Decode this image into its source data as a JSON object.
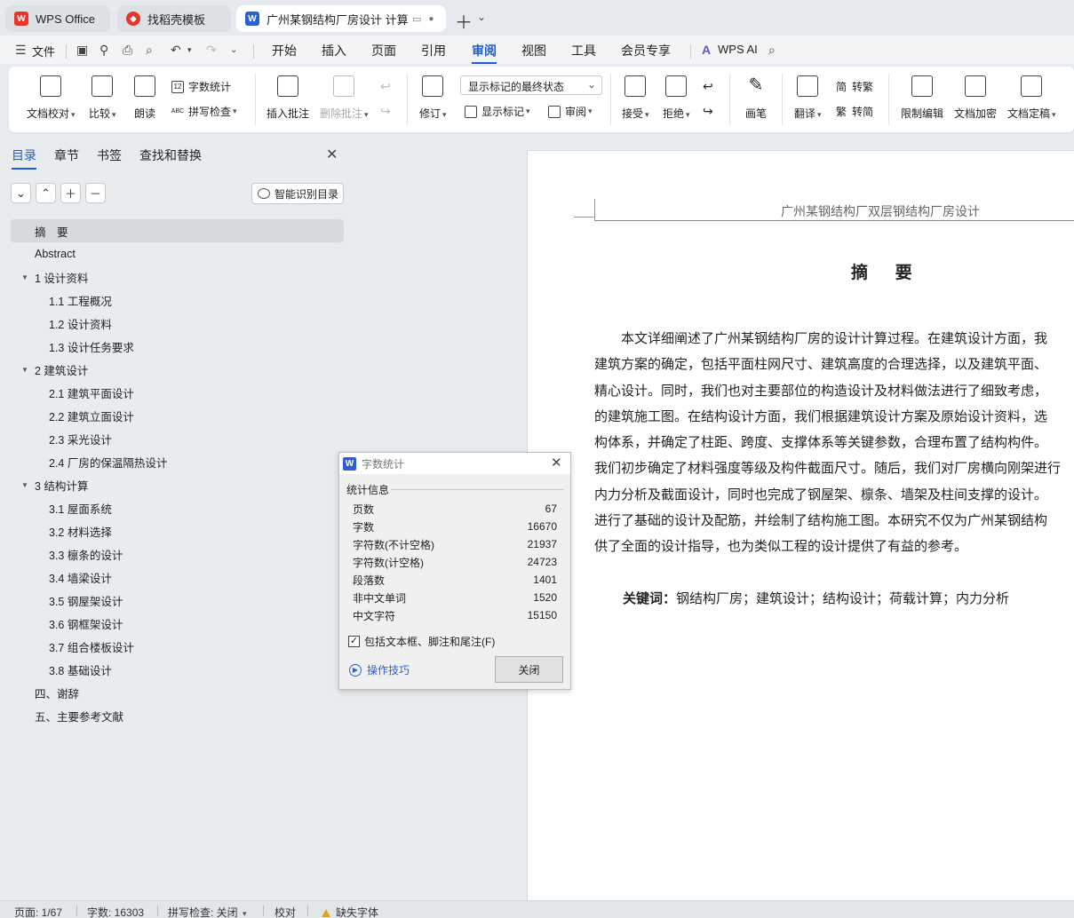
{
  "tabs": [
    {
      "label": "WPS Office",
      "icon": "wps-logo-icon",
      "color": "#e8342a"
    },
    {
      "label": "找稻壳模板",
      "icon": "docer-logo-icon",
      "color": "#e8342a"
    },
    {
      "label": "广州某钢结构厂房设计 计算说",
      "icon": "word-doc-icon",
      "color": "#2b5fd6"
    }
  ],
  "menubar": {
    "file": "文件",
    "items": [
      "开始",
      "插入",
      "页面",
      "引用",
      "审阅",
      "视图",
      "工具",
      "会员专享"
    ],
    "active": "审阅",
    "ai": "WPS AI"
  },
  "ribbon": {
    "proofread": "文档校对",
    "compare": "比较",
    "read_aloud": "朗读",
    "word_count": "字数统计",
    "spell_check": "拼写检查",
    "insert_comment": "插入批注",
    "delete_comment": "删除批注",
    "revise": "修订",
    "markup_state": "显示标记的最终状态",
    "show_markup": "显示标记",
    "review": "审阅",
    "accept": "接受",
    "reject": "拒绝",
    "pen": "画笔",
    "translate": "翻译",
    "to_traditional": "转繁",
    "to_simplified": "转简",
    "restrict_edit": "限制编辑",
    "encrypt": "文档加密",
    "finalize": "文档定稿"
  },
  "sidebar": {
    "tabs": [
      "目录",
      "章节",
      "书签",
      "查找和替换"
    ],
    "smart_toc": "智能识别目录",
    "toc": [
      {
        "label": "摘　要",
        "level": 0,
        "selected": true
      },
      {
        "label": "Abstract",
        "level": 0
      },
      {
        "label": "1 设计资料",
        "level": 0,
        "expanded": true
      },
      {
        "label": "1.1 工程概况",
        "level": 1
      },
      {
        "label": "1.2 设计资料",
        "level": 1
      },
      {
        "label": "1.3 设计任务要求",
        "level": 1
      },
      {
        "label": "2 建筑设计",
        "level": 0,
        "expanded": true
      },
      {
        "label": "2.1 建筑平面设计",
        "level": 1
      },
      {
        "label": "2.2 建筑立面设计",
        "level": 1
      },
      {
        "label": "2.3  采光设计",
        "level": 1
      },
      {
        "label": "2.4  厂房的保温隔热设计",
        "level": 1
      },
      {
        "label": "3 结构计算",
        "level": 0,
        "expanded": true
      },
      {
        "label": "3.1 屋面系统",
        "level": 1
      },
      {
        "label": "3.2 材料选择",
        "level": 1
      },
      {
        "label": "3.3 檩条的设计",
        "level": 1
      },
      {
        "label": "3.4  墙梁设计",
        "level": 1
      },
      {
        "label": "3.5  钢屋架设计",
        "level": 1
      },
      {
        "label": "3.6 钢框架设计",
        "level": 1
      },
      {
        "label": "3.7 组合楼板设计",
        "level": 1
      },
      {
        "label": "3.8 基础设计",
        "level": 1
      },
      {
        "label": "四、谢辞",
        "level": 0
      },
      {
        "label": "五、主要参考文献",
        "level": 0
      }
    ]
  },
  "document": {
    "header": "广州某钢结构厂双层钢结构厂房设计",
    "heading_mark": "H1",
    "title": "摘 要",
    "paragraph_lines": [
      "　　本文详细阐述了广州某钢结构厂房的设计计算过程。在建筑设计方面，我",
      "建筑方案的确定，包括平面柱网尺寸、建筑高度的合理选择，以及建筑平面、",
      "精心设计。同时，我们也对主要部位的构造设计及材料做法进行了细致考虑，",
      "的建筑施工图。在结构设计方面，我们根据建筑设计方案及原始设计资料，选",
      "构体系，并确定了柱距、跨度、支撑体系等关键参数，合理布置了结构构件。",
      "我们初步确定了材料强度等级及构件截面尺寸。随后，我们对厂房横向刚架进行",
      "内力分析及截面设计，同时也完成了钢屋架、檩条、墙架及柱间支撑的设计。",
      "进行了基础的设计及配筋，并绘制了结构施工图。本研究不仅为广州某钢结构",
      "供了全面的设计指导，也为类似工程的设计提供了有益的参考。"
    ],
    "keywords_label": "关键词：",
    "keywords": "钢结构厂房；建筑设计；结构设计；荷载计算；内力分析"
  },
  "dialog": {
    "title": "字数统计",
    "group": "统计信息",
    "stats": [
      {
        "label": "页数",
        "value": "67"
      },
      {
        "label": "字数",
        "value": "16670"
      },
      {
        "label": "字符数(不计空格)",
        "value": "21937"
      },
      {
        "label": "字符数(计空格)",
        "value": "24723"
      },
      {
        "label": "段落数",
        "value": "1401"
      },
      {
        "label": "非中文单词",
        "value": "1520"
      },
      {
        "label": "中文字符",
        "value": "15150"
      }
    ],
    "checkbox": "包括文本框、脚注和尾注(F)",
    "checkbox_checked": true,
    "tips": "操作技巧",
    "close": "关闭"
  },
  "statusbar": {
    "page": "页面: 1/67",
    "words": "字数: 16303",
    "spell": "拼写检查: 关闭",
    "proof": "校对",
    "missing_font": "缺失字体"
  },
  "colors": {
    "accent": "#1f5bd6",
    "warning": "#e0a31a"
  }
}
